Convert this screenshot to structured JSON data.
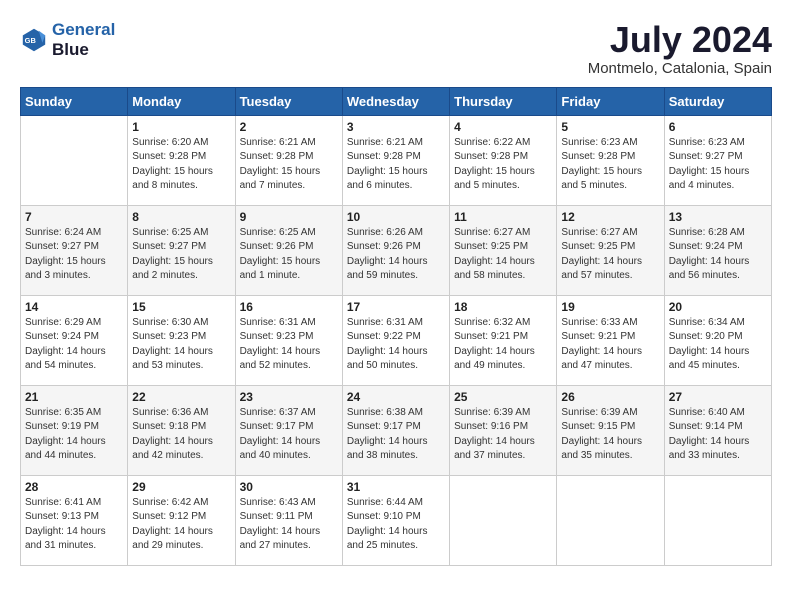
{
  "header": {
    "logo_line1": "General",
    "logo_line2": "Blue",
    "month": "July 2024",
    "location": "Montmelo, Catalonia, Spain"
  },
  "days_of_week": [
    "Sunday",
    "Monday",
    "Tuesday",
    "Wednesday",
    "Thursday",
    "Friday",
    "Saturday"
  ],
  "weeks": [
    [
      {
        "day": "",
        "content": ""
      },
      {
        "day": "1",
        "content": "Sunrise: 6:20 AM\nSunset: 9:28 PM\nDaylight: 15 hours\nand 8 minutes."
      },
      {
        "day": "2",
        "content": "Sunrise: 6:21 AM\nSunset: 9:28 PM\nDaylight: 15 hours\nand 7 minutes."
      },
      {
        "day": "3",
        "content": "Sunrise: 6:21 AM\nSunset: 9:28 PM\nDaylight: 15 hours\nand 6 minutes."
      },
      {
        "day": "4",
        "content": "Sunrise: 6:22 AM\nSunset: 9:28 PM\nDaylight: 15 hours\nand 5 minutes."
      },
      {
        "day": "5",
        "content": "Sunrise: 6:23 AM\nSunset: 9:28 PM\nDaylight: 15 hours\nand 5 minutes."
      },
      {
        "day": "6",
        "content": "Sunrise: 6:23 AM\nSunset: 9:27 PM\nDaylight: 15 hours\nand 4 minutes."
      }
    ],
    [
      {
        "day": "7",
        "content": "Sunrise: 6:24 AM\nSunset: 9:27 PM\nDaylight: 15 hours\nand 3 minutes."
      },
      {
        "day": "8",
        "content": "Sunrise: 6:25 AM\nSunset: 9:27 PM\nDaylight: 15 hours\nand 2 minutes."
      },
      {
        "day": "9",
        "content": "Sunrise: 6:25 AM\nSunset: 9:26 PM\nDaylight: 15 hours\nand 1 minute."
      },
      {
        "day": "10",
        "content": "Sunrise: 6:26 AM\nSunset: 9:26 PM\nDaylight: 14 hours\nand 59 minutes."
      },
      {
        "day": "11",
        "content": "Sunrise: 6:27 AM\nSunset: 9:25 PM\nDaylight: 14 hours\nand 58 minutes."
      },
      {
        "day": "12",
        "content": "Sunrise: 6:27 AM\nSunset: 9:25 PM\nDaylight: 14 hours\nand 57 minutes."
      },
      {
        "day": "13",
        "content": "Sunrise: 6:28 AM\nSunset: 9:24 PM\nDaylight: 14 hours\nand 56 minutes."
      }
    ],
    [
      {
        "day": "14",
        "content": "Sunrise: 6:29 AM\nSunset: 9:24 PM\nDaylight: 14 hours\nand 54 minutes."
      },
      {
        "day": "15",
        "content": "Sunrise: 6:30 AM\nSunset: 9:23 PM\nDaylight: 14 hours\nand 53 minutes."
      },
      {
        "day": "16",
        "content": "Sunrise: 6:31 AM\nSunset: 9:23 PM\nDaylight: 14 hours\nand 52 minutes."
      },
      {
        "day": "17",
        "content": "Sunrise: 6:31 AM\nSunset: 9:22 PM\nDaylight: 14 hours\nand 50 minutes."
      },
      {
        "day": "18",
        "content": "Sunrise: 6:32 AM\nSunset: 9:21 PM\nDaylight: 14 hours\nand 49 minutes."
      },
      {
        "day": "19",
        "content": "Sunrise: 6:33 AM\nSunset: 9:21 PM\nDaylight: 14 hours\nand 47 minutes."
      },
      {
        "day": "20",
        "content": "Sunrise: 6:34 AM\nSunset: 9:20 PM\nDaylight: 14 hours\nand 45 minutes."
      }
    ],
    [
      {
        "day": "21",
        "content": "Sunrise: 6:35 AM\nSunset: 9:19 PM\nDaylight: 14 hours\nand 44 minutes."
      },
      {
        "day": "22",
        "content": "Sunrise: 6:36 AM\nSunset: 9:18 PM\nDaylight: 14 hours\nand 42 minutes."
      },
      {
        "day": "23",
        "content": "Sunrise: 6:37 AM\nSunset: 9:17 PM\nDaylight: 14 hours\nand 40 minutes."
      },
      {
        "day": "24",
        "content": "Sunrise: 6:38 AM\nSunset: 9:17 PM\nDaylight: 14 hours\nand 38 minutes."
      },
      {
        "day": "25",
        "content": "Sunrise: 6:39 AM\nSunset: 9:16 PM\nDaylight: 14 hours\nand 37 minutes."
      },
      {
        "day": "26",
        "content": "Sunrise: 6:39 AM\nSunset: 9:15 PM\nDaylight: 14 hours\nand 35 minutes."
      },
      {
        "day": "27",
        "content": "Sunrise: 6:40 AM\nSunset: 9:14 PM\nDaylight: 14 hours\nand 33 minutes."
      }
    ],
    [
      {
        "day": "28",
        "content": "Sunrise: 6:41 AM\nSunset: 9:13 PM\nDaylight: 14 hours\nand 31 minutes."
      },
      {
        "day": "29",
        "content": "Sunrise: 6:42 AM\nSunset: 9:12 PM\nDaylight: 14 hours\nand 29 minutes."
      },
      {
        "day": "30",
        "content": "Sunrise: 6:43 AM\nSunset: 9:11 PM\nDaylight: 14 hours\nand 27 minutes."
      },
      {
        "day": "31",
        "content": "Sunrise: 6:44 AM\nSunset: 9:10 PM\nDaylight: 14 hours\nand 25 minutes."
      },
      {
        "day": "",
        "content": ""
      },
      {
        "day": "",
        "content": ""
      },
      {
        "day": "",
        "content": ""
      }
    ]
  ]
}
